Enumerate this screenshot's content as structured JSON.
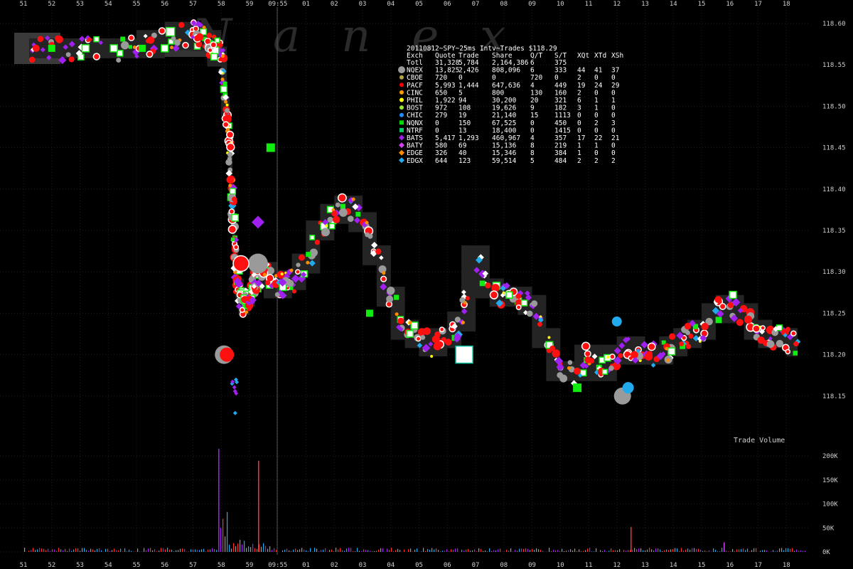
{
  "chart_data": {
    "type": "scatter",
    "title": "20110812~SPY~25ms Intv~Trades $118.29",
    "watermark": "Nanex",
    "volume_label": "Trade Volume",
    "x_ticks": [
      "51",
      "52",
      "53",
      "54",
      "55",
      "56",
      "57",
      "58",
      "59",
      "09:55",
      "01",
      "02",
      "03",
      "04",
      "05",
      "06",
      "07",
      "08",
      "09",
      "10",
      "11",
      "12",
      "13",
      "14",
      "15",
      "16",
      "17",
      "18"
    ],
    "price_ticks": [
      "118.60",
      "118.55",
      "118.50",
      "118.45",
      "118.40",
      "118.35",
      "118.30",
      "118.25",
      "118.20",
      "118.15"
    ],
    "ylim": [
      118.12,
      118.62
    ],
    "volume_ticks": [
      "200K",
      "150K",
      "100K",
      "50K",
      "0K"
    ],
    "volume_ylim": [
      0,
      220000
    ],
    "legend_headers": [
      "Exch",
      "Quote",
      "Trade",
      "Share",
      "Q/T",
      "S/T",
      "XQt",
      "XTd",
      "XSh"
    ],
    "legend_rows": [
      {
        "exch": "Totl",
        "quote": "31,328",
        "trade": "5,784",
        "share": "2,164,386",
        "qt": "6",
        "st": "375",
        "xqt": "",
        "xtd": "",
        "xsh": "",
        "color": "",
        "shape": "none"
      },
      {
        "exch": "NQEX",
        "quote": "13,825",
        "trade": "2,426",
        "share": "808,096",
        "qt": "6",
        "st": "333",
        "xqt": "44",
        "xtd": "41",
        "xsh": "37",
        "color": "#9a9a9a",
        "shape": "circle"
      },
      {
        "exch": "CBOE",
        "quote": "720",
        "trade": "0",
        "share": "0",
        "qt": "720",
        "st": "0",
        "xqt": "2",
        "xtd": "0",
        "xsh": "0",
        "color": "#b5a642",
        "shape": "circle"
      },
      {
        "exch": "PACF",
        "quote": "5,993",
        "trade": "1,444",
        "share": "647,636",
        "qt": "4",
        "st": "449",
        "xqt": "19",
        "xtd": "24",
        "xsh": "29",
        "color": "#ff0000",
        "shape": "circle"
      },
      {
        "exch": "CINC",
        "quote": "650",
        "trade": "5",
        "share": "800",
        "qt": "130",
        "st": "160",
        "xqt": "2",
        "xtd": "0",
        "xsh": "0",
        "color": "#ff9900",
        "shape": "circle"
      },
      {
        "exch": "PHIL",
        "quote": "1,922",
        "trade": "94",
        "share": "30,200",
        "qt": "20",
        "st": "321",
        "xqt": "6",
        "xtd": "1",
        "xsh": "1",
        "color": "#ffff00",
        "shape": "circle"
      },
      {
        "exch": "BOST",
        "quote": "972",
        "trade": "108",
        "share": "19,626",
        "qt": "9",
        "st": "182",
        "xqt": "3",
        "xtd": "1",
        "xsh": "0",
        "color": "#9ae62e",
        "shape": "circle"
      },
      {
        "exch": "CHIC",
        "quote": "279",
        "trade": "19",
        "share": "21,140",
        "qt": "15",
        "st": "1113",
        "xqt": "0",
        "xtd": "0",
        "xsh": "0",
        "color": "#1e90ff",
        "shape": "circle"
      },
      {
        "exch": "NQNX",
        "quote": "0",
        "trade": "150",
        "share": "67,525",
        "qt": "0",
        "st": "450",
        "xqt": "0",
        "xtd": "2",
        "xsh": "3",
        "color": "#00dd00",
        "shape": "square"
      },
      {
        "exch": "NTRF",
        "quote": "0",
        "trade": "13",
        "share": "18,400",
        "qt": "0",
        "st": "1415",
        "xqt": "0",
        "xtd": "0",
        "xsh": "0",
        "color": "#00cc66",
        "shape": "square"
      },
      {
        "exch": "BATS",
        "quote": "5,417",
        "trade": "1,293",
        "share": "460,967",
        "qt": "4",
        "st": "357",
        "xqt": "17",
        "xtd": "22",
        "xsh": "21",
        "color": "#a020f0",
        "shape": "diamond"
      },
      {
        "exch": "BATY",
        "quote": "580",
        "trade": "69",
        "share": "15,136",
        "qt": "8",
        "st": "219",
        "xqt": "1",
        "xtd": "1",
        "xsh": "0",
        "color": "#cc44ee",
        "shape": "diamond"
      },
      {
        "exch": "EDGE",
        "quote": "326",
        "trade": "40",
        "share": "15,346",
        "qt": "8",
        "st": "384",
        "xqt": "1",
        "xtd": "0",
        "xsh": "0",
        "color": "#ff8c00",
        "shape": "diamond"
      },
      {
        "exch": "EDGX",
        "quote": "644",
        "trade": "123",
        "share": "59,514",
        "qt": "5",
        "st": "484",
        "xqt": "2",
        "xtd": "2",
        "xsh": "2",
        "color": "#22aaee",
        "shape": "diamond"
      }
    ],
    "series_price_path": [
      [
        0.2,
        118.57
      ],
      [
        1,
        118.57
      ],
      [
        2,
        118.57
      ],
      [
        3,
        118.57
      ],
      [
        4,
        118.57
      ],
      [
        5,
        118.58
      ],
      [
        6,
        118.59
      ],
      [
        6.5,
        118.58
      ],
      [
        7,
        118.56
      ],
      [
        7.2,
        118.5
      ],
      [
        7.3,
        118.45
      ],
      [
        7.4,
        118.38
      ],
      [
        7.5,
        118.32
      ],
      [
        7.6,
        118.28
      ],
      [
        7.8,
        118.26
      ],
      [
        8.0,
        118.27
      ],
      [
        8.2,
        118.29
      ],
      [
        8.5,
        118.3
      ],
      [
        9,
        118.28
      ],
      [
        9.5,
        118.29
      ],
      [
        10,
        118.31
      ],
      [
        10.5,
        118.35
      ],
      [
        11,
        118.37
      ],
      [
        11.5,
        118.38
      ],
      [
        12,
        118.36
      ],
      [
        12.5,
        118.32
      ],
      [
        13,
        118.27
      ],
      [
        13.5,
        118.23
      ],
      [
        14,
        118.22
      ],
      [
        14.5,
        118.21
      ],
      [
        15,
        118.22
      ],
      [
        15.5,
        118.24
      ],
      [
        16,
        118.32
      ],
      [
        16.5,
        118.28
      ],
      [
        17,
        118.27
      ],
      [
        17.5,
        118.27
      ],
      [
        18,
        118.26
      ],
      [
        18.5,
        118.22
      ],
      [
        19,
        118.18
      ],
      [
        19.5,
        118.18
      ],
      [
        20,
        118.2
      ],
      [
        20.5,
        118.18
      ],
      [
        21,
        118.2
      ],
      [
        21.5,
        118.21
      ],
      [
        22,
        118.2
      ],
      [
        22.5,
        118.2
      ],
      [
        23,
        118.21
      ],
      [
        23.5,
        118.22
      ],
      [
        24,
        118.23
      ],
      [
        24.5,
        118.25
      ],
      [
        25,
        118.26
      ],
      [
        25.5,
        118.25
      ],
      [
        26,
        118.23
      ],
      [
        26.5,
        118.22
      ],
      [
        27,
        118.22
      ],
      [
        27.4,
        118.21
      ]
    ]
  }
}
